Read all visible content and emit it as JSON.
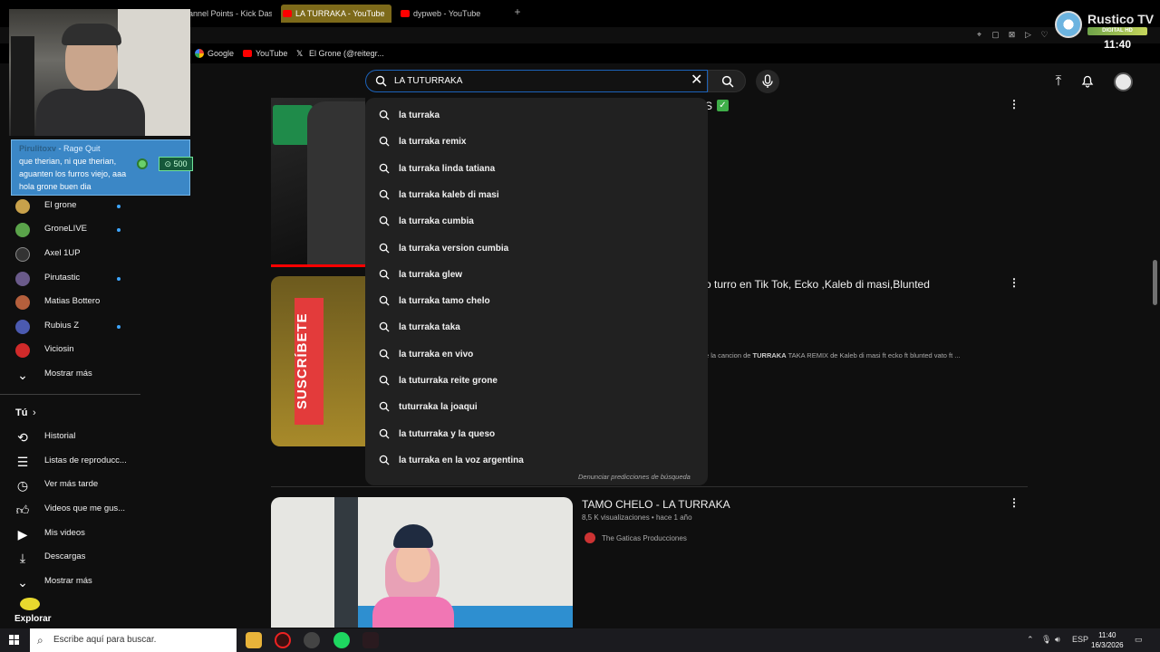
{
  "browser": {
    "tabs": [
      {
        "label": "annel Points - Kick Das"
      },
      {
        "label": "LA TURRAKA - YouTube"
      },
      {
        "label": "dypweb - YouTube"
      }
    ],
    "new_tab": "+",
    "bookmarks": [
      {
        "label": "Google"
      },
      {
        "label": "YouTube"
      },
      {
        "label": "El Grone (@reitegr..."
      }
    ]
  },
  "overlay": {
    "channel_name": "Rustico TV",
    "channel_badge": "DIGITAL HD",
    "time": "11:40",
    "chat": {
      "user": "Pirulitoxv",
      "user_suffix": " - Rage Quit",
      "message": "que therian, ni que therian, aguanten los furros viejo, aaa hola grone buen dia",
      "points": "500"
    }
  },
  "sidebar": {
    "subscriptions": [
      {
        "label": "El grone",
        "live": true,
        "color": "#c8a14b"
      },
      {
        "label": "GroneLIVE",
        "live": true,
        "color": "#5aa34a"
      },
      {
        "label": "Axel 1UP",
        "live": false,
        "color": "#333333"
      },
      {
        "label": "Pirutastic",
        "live": true,
        "color": "#6a5a8a"
      },
      {
        "label": "Matias Bottero",
        "live": false,
        "color": "#b45f3c"
      },
      {
        "label": "Rubius Z",
        "live": true,
        "color": "#4b5ab0"
      },
      {
        "label": "Viciosin",
        "live": false,
        "color": "#d02a2a"
      }
    ],
    "show_more": "Mostrar más",
    "you_section": "Tú",
    "you_items": [
      {
        "label": "Historial"
      },
      {
        "label": "Listas de reproducc..."
      },
      {
        "label": "Ver más tarde"
      },
      {
        "label": "Videos que me gus..."
      },
      {
        "label": "Mis videos"
      },
      {
        "label": "Descargas"
      },
      {
        "label": "Mostrar más"
      }
    ],
    "explore": "Explorar"
  },
  "search": {
    "query": "LA TUTURRAKA",
    "suggestions": [
      "la turraka",
      "la turraka remix",
      "la turraka linda tatiana",
      "la turraka kaleb di masi",
      "la turraka cumbia",
      "la turraka version cumbia",
      "la turraka glew",
      "la turraka tamo chelo",
      "la turraka taka",
      "la turraka en vivo",
      "la tuturraka reite grone",
      "tuturraka la joaqui",
      "la tuturraka y la queso",
      "la turraka en la voz argentina"
    ],
    "report": "Denunciar predicciones de búsqueda"
  },
  "results": {
    "r1_title_tail": "S",
    "r2_title": "o turro en Tik Tok, Ecko ,Kaleb di masi,Blunted",
    "r2_desc_pre": "e la cancion de ",
    "r2_desc_bold": "TURRAKA",
    "r2_desc_post": " TAKA REMIX de Kaleb di masi ft ecko ft blunted vato ft ...",
    "thumb2_text": "SUSCRÍBETE",
    "r3_title": "TAMO CHELO - LA TURRAKA",
    "r3_meta": "8,5 K visualizaciones • hace 1 año",
    "r3_channel": "The Gaticas Producciones"
  },
  "taskbar": {
    "search_placeholder": "Escribe aquí para buscar.",
    "lang": "ESP",
    "time": "11:40",
    "date": "16/3/2026"
  },
  "colors": {
    "accent_blue": "#3ea6ff",
    "youtube_red": "#ff0000",
    "chat_bg": "#3b87c6"
  }
}
